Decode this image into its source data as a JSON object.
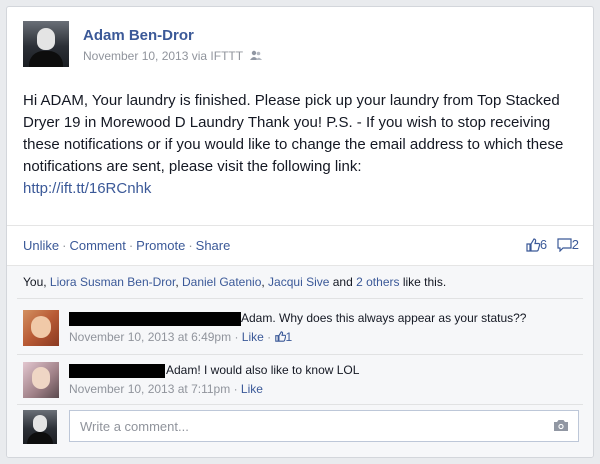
{
  "post": {
    "author": "Adam Ben-Dror",
    "meta": "November 10, 2013 via IFTTT",
    "text": "Hi ADAM, Your laundry is finished. Please pick up your laundry from Top Stacked Dryer 19 in Morewood D Laundry Thank you! P.S. - If you wish to stop receiving these notifications or if you would like to change the email address to which these notifications are sent, please visit the following link:",
    "link": "http://ift.tt/16RCnhk",
    "audience_icon": "friends-icon"
  },
  "actions": {
    "unlike": "Unlike",
    "comment": "Comment",
    "promote": "Promote",
    "share": "Share",
    "sep": "·",
    "like_count": "6",
    "comment_count": "2"
  },
  "likes": {
    "prefix": "You, ",
    "names": [
      "Liora Susman Ben-Dror",
      "Daniel Gatenio",
      "Jacqui Sive"
    ],
    "comma": ", ",
    "and": " and ",
    "others": "2 others",
    "suffix": " like this."
  },
  "comments": [
    {
      "text": "Adam. Why does this always appear as your status??",
      "time": "November 10, 2013 at 6:49pm",
      "like_label": "Like",
      "like_count": "1"
    },
    {
      "text": "Adam! I would also like to know LOL",
      "time": "November 10, 2013 at 7:11pm",
      "like_label": "Like"
    }
  ],
  "write": {
    "placeholder": "Write a comment..."
  },
  "colors": {
    "link": "#3b5998",
    "meta": "#90949c",
    "ufi_bg": "#f6f7f9"
  }
}
